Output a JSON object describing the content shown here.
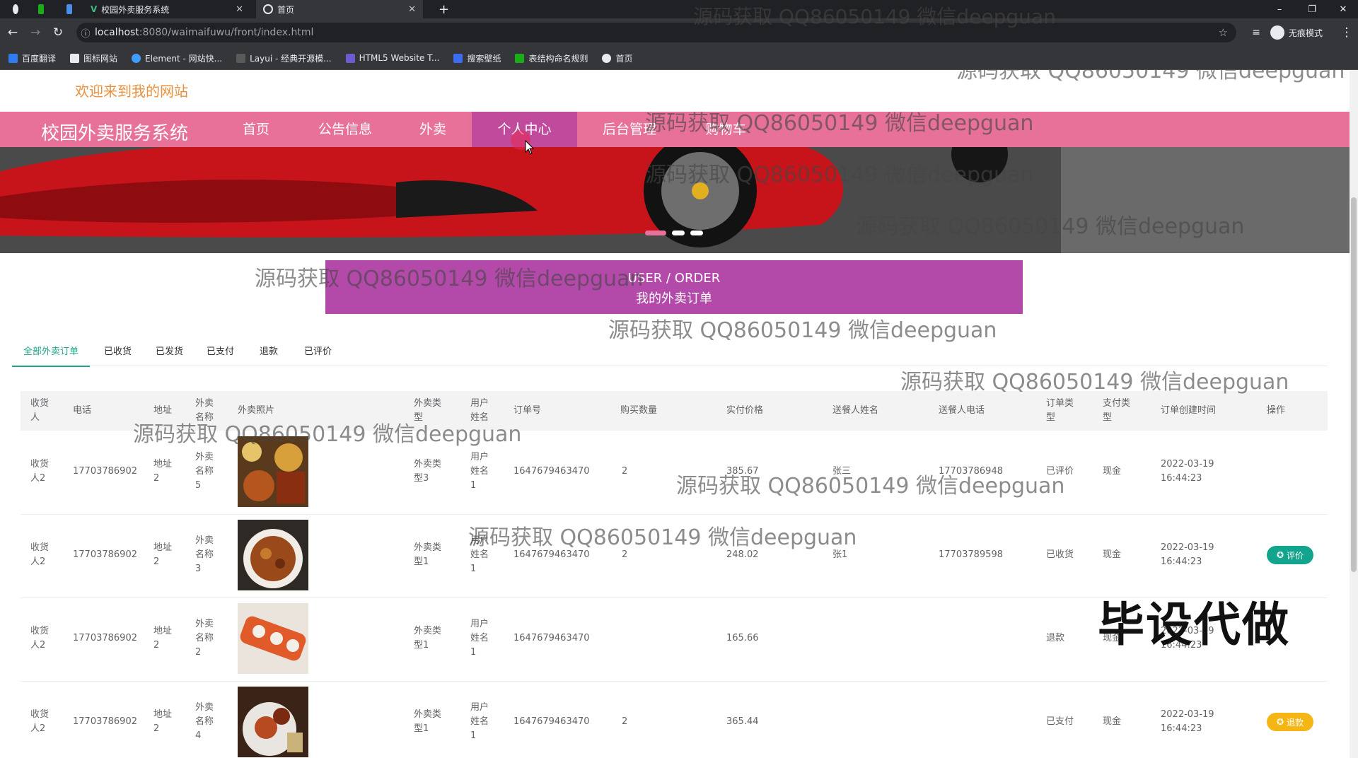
{
  "browser": {
    "tabs": [
      {
        "title": "校园外卖服务系统"
      },
      {
        "title": "首页"
      }
    ],
    "url_host": "localhost",
    "url_path": ":8080/waimaifuwu/front/index.html",
    "profile_label": "无痕模式",
    "bookmarks": [
      "百度翻译",
      "图标网站",
      "Element - 网站快...",
      "Layui - 经典开源模...",
      "HTML5 Website T...",
      "搜索壁纸",
      "表结构命名规则",
      "首页"
    ]
  },
  "site": {
    "welcome": "欢迎来到我的网站",
    "brand": "校园外卖服务系统",
    "nav": [
      "首页",
      "公告信息",
      "外卖",
      "个人中心",
      "后台管理",
      "购物车"
    ],
    "active_nav_index": 3
  },
  "section": {
    "en": "USER / ORDER",
    "zh": "我的外卖订单"
  },
  "order_tabs": [
    "全部外卖订单",
    "已收货",
    "已发货",
    "已支付",
    "退款",
    "已评价"
  ],
  "table": {
    "headers": {
      "receiver": "收货人",
      "phone": "电话",
      "address": "地址",
      "name": "外卖名称",
      "photo": "外卖照片",
      "type": "外卖类型",
      "username": "用户姓名",
      "order_no": "订单号",
      "qty": "购买数量",
      "price": "实付价格",
      "courier": "送餐人姓名",
      "courier_phone": "送餐人电话",
      "order_type": "订单类型",
      "pay_type": "支付类型",
      "created": "订单创建时间",
      "action": "操作"
    },
    "rows": [
      {
        "receiver": "收货人2",
        "phone": "17703786902",
        "address": "地址2",
        "name": "外卖名称5",
        "type": "外卖类型3",
        "username": "用户姓名1",
        "order_no": "1647679463470",
        "qty": "2",
        "price": "385.67",
        "courier": "张三",
        "courier_phone": "17703786948",
        "order_type": "已评价",
        "pay_type": "现金",
        "created": "2022-03-19 16:44:23",
        "action": ""
      },
      {
        "receiver": "收货人2",
        "phone": "17703786902",
        "address": "地址2",
        "name": "外卖名称3",
        "type": "外卖类型1",
        "username": "用户姓名1",
        "order_no": "1647679463470",
        "qty": "2",
        "price": "248.02",
        "courier": "张1",
        "courier_phone": "17703789598",
        "order_type": "已收货",
        "pay_type": "现金",
        "created": "2022-03-19 16:44:23",
        "action": "评价"
      },
      {
        "receiver": "收货人2",
        "phone": "17703786902",
        "address": "地址2",
        "name": "外卖名称2",
        "type": "外卖类型1",
        "username": "用户姓名1",
        "order_no": "1647679463470",
        "qty": "",
        "price": "165.66",
        "courier": "",
        "courier_phone": "",
        "order_type": "退款",
        "pay_type": "现金",
        "created": "2022-03-19 16:44:23",
        "action": ""
      },
      {
        "receiver": "收货人2",
        "phone": "17703786902",
        "address": "地址2",
        "name": "外卖名称4",
        "type": "外卖类型1",
        "username": "用户姓名1",
        "order_no": "1647679463470",
        "qty": "2",
        "price": "365.44",
        "courier": "",
        "courier_phone": "",
        "order_type": "已支付",
        "pay_type": "现金",
        "created": "2022-03-19 16:44:23",
        "action": "退款"
      }
    ]
  },
  "overlays": {
    "watermark": "源码获取 QQ86050149 微信deepguan",
    "stamp": "毕设代做"
  }
}
